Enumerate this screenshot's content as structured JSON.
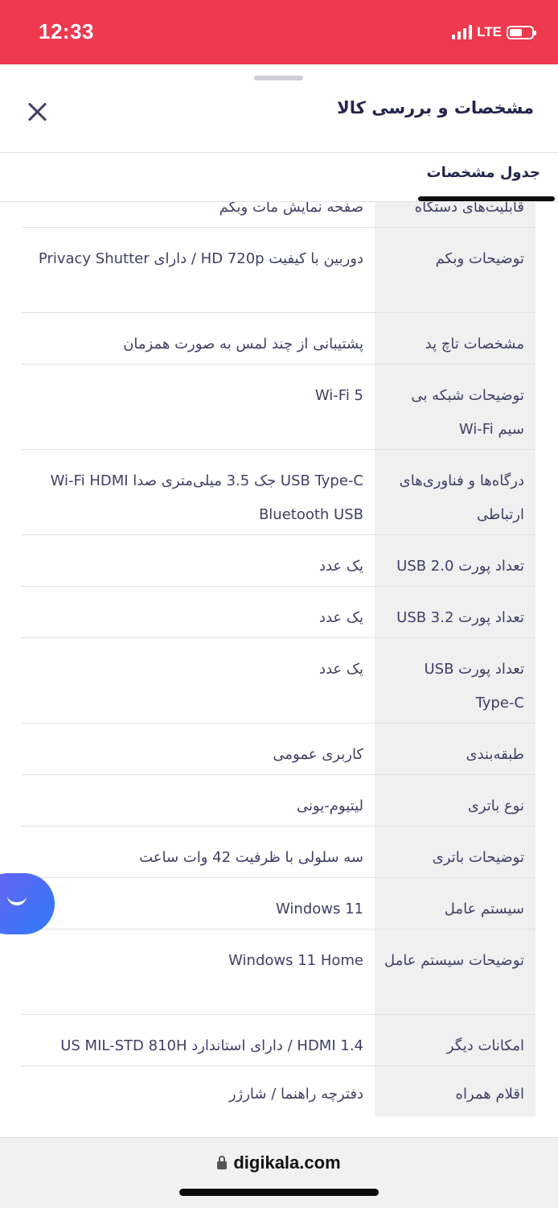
{
  "status_bar": {
    "time": "12:33",
    "network": "LTE"
  },
  "sheet": {
    "title": "مشخصات و بررسی کالا",
    "tab_label": "جدول مشخصات"
  },
  "specs": [
    {
      "key": "قابلیت‌های دستگاه",
      "value": "صفحه نمایش مات وبکم"
    },
    {
      "key": "توضیحات وبکم",
      "value": "دوربین با کیفیت HD 720p / دارای Privacy Shutter"
    },
    {
      "key": "مشخصات تاچ پد",
      "value": "پشتیبانی از چند لمس به صورت همزمان"
    },
    {
      "key": "توضیحات شبکه بی سیم Wi-Fi",
      "value": "Wi-Fi 5"
    },
    {
      "key": "درگاه‌ها و فناوری‌های ارتباطی",
      "value": "USB Type-C جک 3.5 میلی‌متری صدا Wi-Fi HDMI Bluetooth USB"
    },
    {
      "key": "تعداد پورت USB 2.0",
      "value": "یک عدد"
    },
    {
      "key": "تعداد پورت USB 3.2",
      "value": "یک عدد"
    },
    {
      "key": "تعداد پورت USB Type-C",
      "value": "یک عدد"
    },
    {
      "key": "طبقه‌بندی",
      "value": "کاربری عمومی"
    },
    {
      "key": "نوع باتری",
      "value": "لیتیوم-یونی"
    },
    {
      "key": "توضیحات باتری",
      "value": "سه سلولی با ظرفیت 42 وات ساعت"
    },
    {
      "key": "سیستم عامل",
      "value": "Windows 11"
    },
    {
      "key": "توضیحات سیستم عامل",
      "value": "Windows 11 Home"
    },
    {
      "key": "امکانات دیگر",
      "value": "HDMI 1.4 / دارای استاندارد US MIL-STD 810H"
    },
    {
      "key": "اقلام همراه",
      "value": "دفترچه راهنما / شارژر"
    }
  ],
  "browser": {
    "url": "digikala.com"
  },
  "icons": [
    "close-icon",
    "chat-icon",
    "lock-icon",
    "signal-icon",
    "battery-icon"
  ],
  "colors": {
    "brand": "#ef394e",
    "chat_button": "#4b6cf5"
  }
}
